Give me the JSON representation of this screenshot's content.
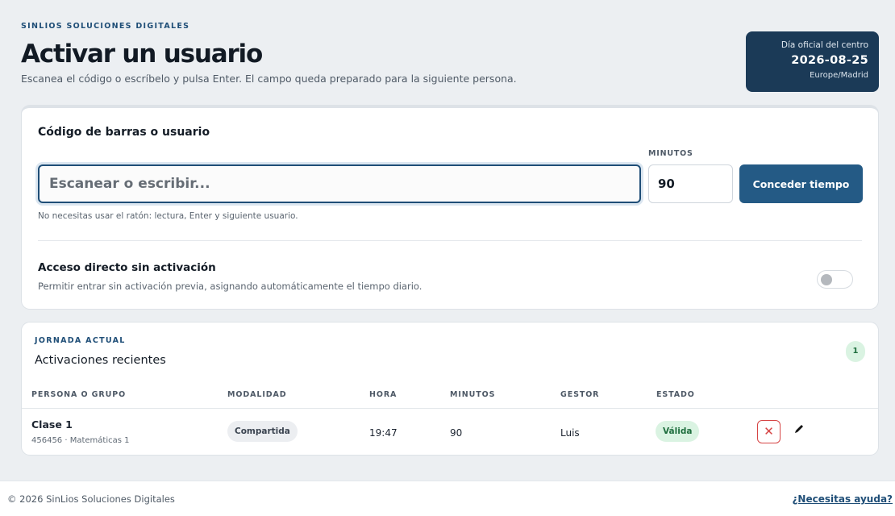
{
  "header": {
    "brand": "SINLIOS SOLUCIONES DIGITALES",
    "title": "Activar un usuario",
    "subtitle": "Escanea el código o escríbelo y pulsa Enter. El campo queda preparado para la siguiente persona."
  },
  "date_card": {
    "label": "Día oficial del centro",
    "date": "2026-08-25",
    "timezone": "Europe/Madrid"
  },
  "activation": {
    "title": "Código de barras o usuario",
    "code_placeholder": "Escanear o escribir...",
    "code_value": "",
    "minutes_label": "MINUTOS",
    "minutes_value": "90",
    "grant_button": "Conceder tiempo",
    "hint": "No necesitas usar el ratón: lectura, Enter y siguiente usuario."
  },
  "direct_access": {
    "title": "Acceso directo sin activación",
    "description": "Permitir entrar sin activación previa, asignando automáticamente el tiempo diario.",
    "enabled": false
  },
  "recent": {
    "kicker": "JORNADA ACTUAL",
    "title": "Activaciones recientes",
    "count": "1",
    "columns": [
      "PERSONA O GRUPO",
      "MODALIDAD",
      "HORA",
      "MINUTOS",
      "GESTOR",
      "ESTADO"
    ],
    "rows": [
      {
        "name": "Clase 1",
        "meta": "456456 · Matemáticas 1",
        "mode": "Compartida",
        "time": "19:47",
        "minutes": "90",
        "manager": "Luis",
        "state": "Válida"
      }
    ]
  },
  "footer": {
    "copyright": "© 2026 SinLios Soluciones Digitales",
    "help": "¿Necesitas ayuda?"
  },
  "colors": {
    "primary": "#1f4e77",
    "button": "#245a85",
    "date_card": "#1b3a57",
    "success_bg": "#daf3e2",
    "success_text": "#1f6e3e",
    "danger": "#d64545"
  }
}
